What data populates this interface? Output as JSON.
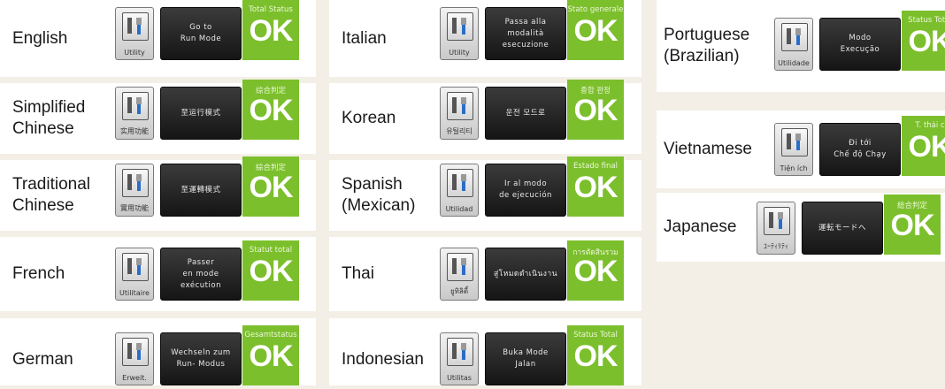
{
  "cards": [
    {
      "language": "English",
      "utility": "Utility",
      "run": "Go to\nRun Mode",
      "status": "Total Status",
      "ok": "OK"
    },
    {
      "language": "Simplified\nChinese",
      "utility": "实用功能",
      "run": "至运行模式",
      "status": "综合判定",
      "ok": "OK"
    },
    {
      "language": "Traditional\nChinese",
      "utility": "實用功能",
      "run": "至運轉模式",
      "status": "綜合判定",
      "ok": "OK"
    },
    {
      "language": "French",
      "utility": "Utilitaire",
      "run": "Passer\nen mode\nexécution",
      "status": "Statut total",
      "ok": "OK"
    },
    {
      "language": "German",
      "utility": "Erweit.",
      "run": "Wechseln zum\nRun- Modus",
      "status": "Gesamtstatus",
      "ok": "OK"
    },
    {
      "language": "Italian",
      "utility": "Utility",
      "run": "Passa alla\nmodalità\nesecuzione",
      "status": "Stato generale",
      "ok": "OK"
    },
    {
      "language": "Korean",
      "utility": "유틸리티",
      "run": "운전 모드로",
      "status": "종합 판정",
      "ok": "OK"
    },
    {
      "language": "Spanish\n(Mexican)",
      "utility": "Utilidad",
      "run": "Ir al modo\nde ejecución",
      "status": "Estado final",
      "ok": "OK"
    },
    {
      "language": "Thai",
      "utility": "ยูทิลิตี้",
      "run": "สู่โหมดดำเนินงาน",
      "status": "การตัดสินรวม",
      "ok": "OK"
    },
    {
      "language": "Indonesian",
      "utility": "Utilitas",
      "run": "Buka Mode\nJalan",
      "status": "Status Total",
      "ok": "OK"
    },
    {
      "language": "Portuguese\n(Brazilian)",
      "utility": "Utilidade",
      "run": "Modo\nExecução",
      "status": "Status Total",
      "ok": "OK"
    },
    {
      "language": "Vietnamese",
      "utility": "Tiện ích",
      "run": "Đi tới\nChế độ Chạy",
      "status": "T. thái c",
      "ok": "OK"
    },
    {
      "language": "Japanese",
      "utility": "ﾕｰﾃｨﾘﾃｨ",
      "run": "運転モードへ",
      "status": "総合判定",
      "ok": "OK"
    }
  ]
}
